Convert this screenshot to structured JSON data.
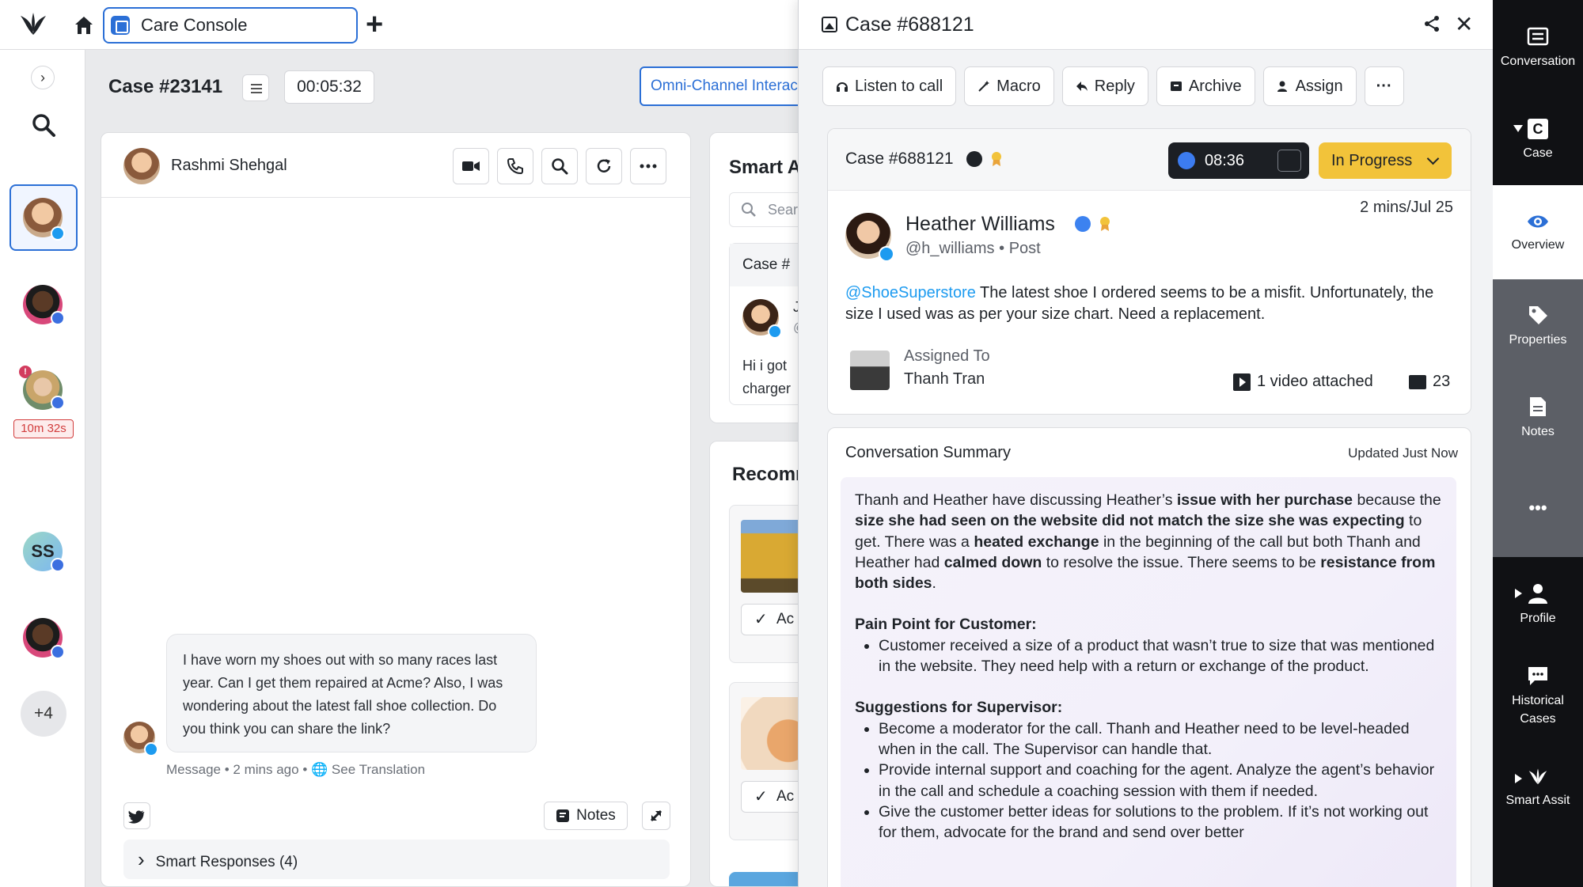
{
  "topbar": {
    "tab_label": "Care Console",
    "logo_icon": "sprinklr-logo-icon",
    "home_icon": "home-icon",
    "add_icon": "plus-icon",
    "add_glyph": "+"
  },
  "left_rail": {
    "toggle_glyph": "›",
    "timer_label": "10m 32s",
    "alert_glyph": "!",
    "initials_avatar": "SS",
    "more_label": "+4"
  },
  "case_header": {
    "title": "Case #23141",
    "timer": "00:05:32",
    "omni_button": "Omni-Channel Interactions"
  },
  "conversation": {
    "customer_name": "Rashmi Shehgal",
    "message": "I have worn my shoes out with so many races last year. Can I get them repaired at Acme? Also, I was wondering about the latest fall shoe collection. Do you think you can share the link?",
    "message_type": "Message",
    "time_ago": "2 mins ago",
    "translation_link": "See Translation",
    "notes_label": "Notes",
    "smart_responses_label": "Smart Responses (4)",
    "expand_glyph": "›",
    "separator": "•"
  },
  "smart_assist": {
    "title": "Smart Assist",
    "search_placeholder": "Search",
    "card_header": "Case #",
    "card_user_initial": "J",
    "card_user_extra": "@",
    "card_text_1": "Hi i got",
    "card_text_2": "charger"
  },
  "recommendations": {
    "title": "Recommendations",
    "add_label": "Ac"
  },
  "case_panel": {
    "title": "Case #688121",
    "close_glyph": "✕",
    "actions": [
      "Listen to call",
      "Macro",
      "Reply",
      "Archive",
      "Assign"
    ],
    "more_glyph": "···",
    "case_id": "Case #688121",
    "call_timer": "08:36",
    "status": "In Progress",
    "author_name": "Heather Williams",
    "author_handle": "@h_williams",
    "post_type": "Post",
    "handle_separator": "•",
    "post_time": "2 mins/Jul 25",
    "post_mention": "@ShoeSuperstore",
    "post_text": " The latest shoe I ordered seems to be a misfit. Unfortunately, the size I used was as per your size chart. Need a replacement.",
    "assigned_label": "Assigned To",
    "assigned_name": "Thanh Tran",
    "attachment": "1 video attached",
    "comment_count": "23"
  },
  "summary": {
    "title": "Conversation Summary",
    "updated": "Updated Just Now",
    "p1": "Thanh and Heather have discussing Heather’s ",
    "p1_b1": "issue with her purchase",
    "p1_t2": " because the ",
    "p1_b2": "size she had seen on the website did not match the size she was expecting",
    "p1_t3": " to get. There was a ",
    "p1_b3": "heated exchange",
    "p1_t4": " in the beginning of the call but both Thanh and Heather had ",
    "p1_b4": "calmed down",
    "p1_t5": " to resolve the issue. There seems to be ",
    "p1_b5": "resistance from both sides",
    "p1_t6": ".",
    "pain_title": "Pain Point for Customer:",
    "pain_items": [
      "Customer received a size of a product that wasn’t true to size that was mentioned in the website. They need help with a return or exchange of the product."
    ],
    "sugg_title": "Suggestions for Supervisor:",
    "sugg_items": [
      "Become a moderator for the call. Thanh and Heather need to be level-headed when in the call. The Supervisor can handle that.",
      "Provide internal support and coaching for the agent. Analyze the agent’s behavior in the call and schedule a coaching session with them if needed.",
      "Give the customer better ideas for solutions to the problem. If it’s not working out for them, advocate for the brand and send over better"
    ]
  },
  "right_rail": {
    "items": [
      "Conversation",
      "Case",
      "Overview",
      "Properties",
      "Notes",
      "Profile",
      "Historical Cases",
      "Smart Assit"
    ],
    "case_glyph": "C",
    "more_glyph": "•••"
  },
  "colors": {
    "accent": "#2b6fd6",
    "status_yellow": "#f2c33a",
    "twitter": "#1d9bf0",
    "facebook": "#3b6fe0"
  }
}
